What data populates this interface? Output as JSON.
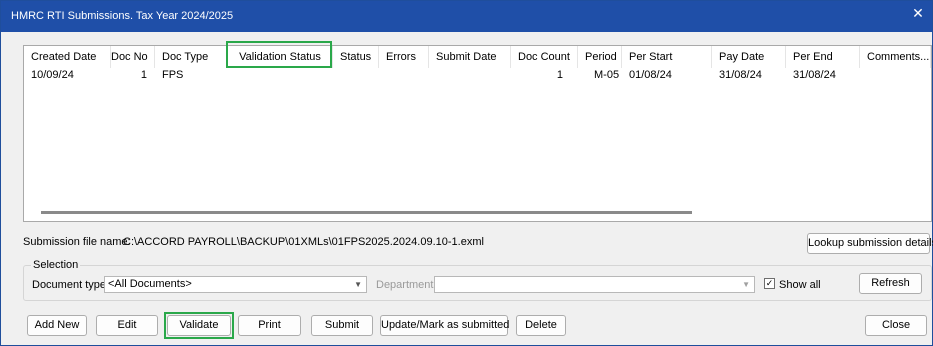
{
  "window": {
    "title": "HMRC RTI Submissions. Tax Year 2024/2025",
    "close_glyph": "✕"
  },
  "table": {
    "columns": [
      "Created Date",
      "Doc No",
      "Doc Type",
      "Validation Status",
      "Status",
      "Errors",
      "Submit Date",
      "Doc Count",
      "Period",
      "Per Start",
      "Pay Date",
      "Per End",
      "Comments..."
    ],
    "rows": [
      {
        "created_date": "10/09/24",
        "doc_no": "1",
        "doc_type": "FPS",
        "validation_status": "",
        "status": "",
        "errors": "",
        "submit_date": "",
        "doc_count": "1",
        "period": "M-05",
        "per_start": "01/08/24",
        "pay_date": "31/08/24",
        "per_end": "31/08/24",
        "comments": ""
      }
    ],
    "highlighted_column": "Validation Status"
  },
  "submission": {
    "label": "Submission file name:",
    "path": "C:\\ACCORD PAYROLL\\BACKUP\\01XMLs\\01FPS2025.2024.09.10-1.exml",
    "lookup_button": "Lookup submission details"
  },
  "selection": {
    "legend": "Selection",
    "doc_types_label": "Document types:",
    "doc_types_value": "<All Documents>",
    "departments_label": "Departments:",
    "departments_value": "",
    "show_all_label": "Show all",
    "show_all_checked": true,
    "refresh_button": "Refresh"
  },
  "buttons": {
    "add_new": "Add New",
    "edit": "Edit",
    "validate": "Validate",
    "print": "Print",
    "submit": "Submit",
    "update": "Update/Mark as submitted",
    "delete": "Delete",
    "close": "Close"
  },
  "colors": {
    "titlebar": "#1f4fa8",
    "highlight": "#2aa84a"
  }
}
